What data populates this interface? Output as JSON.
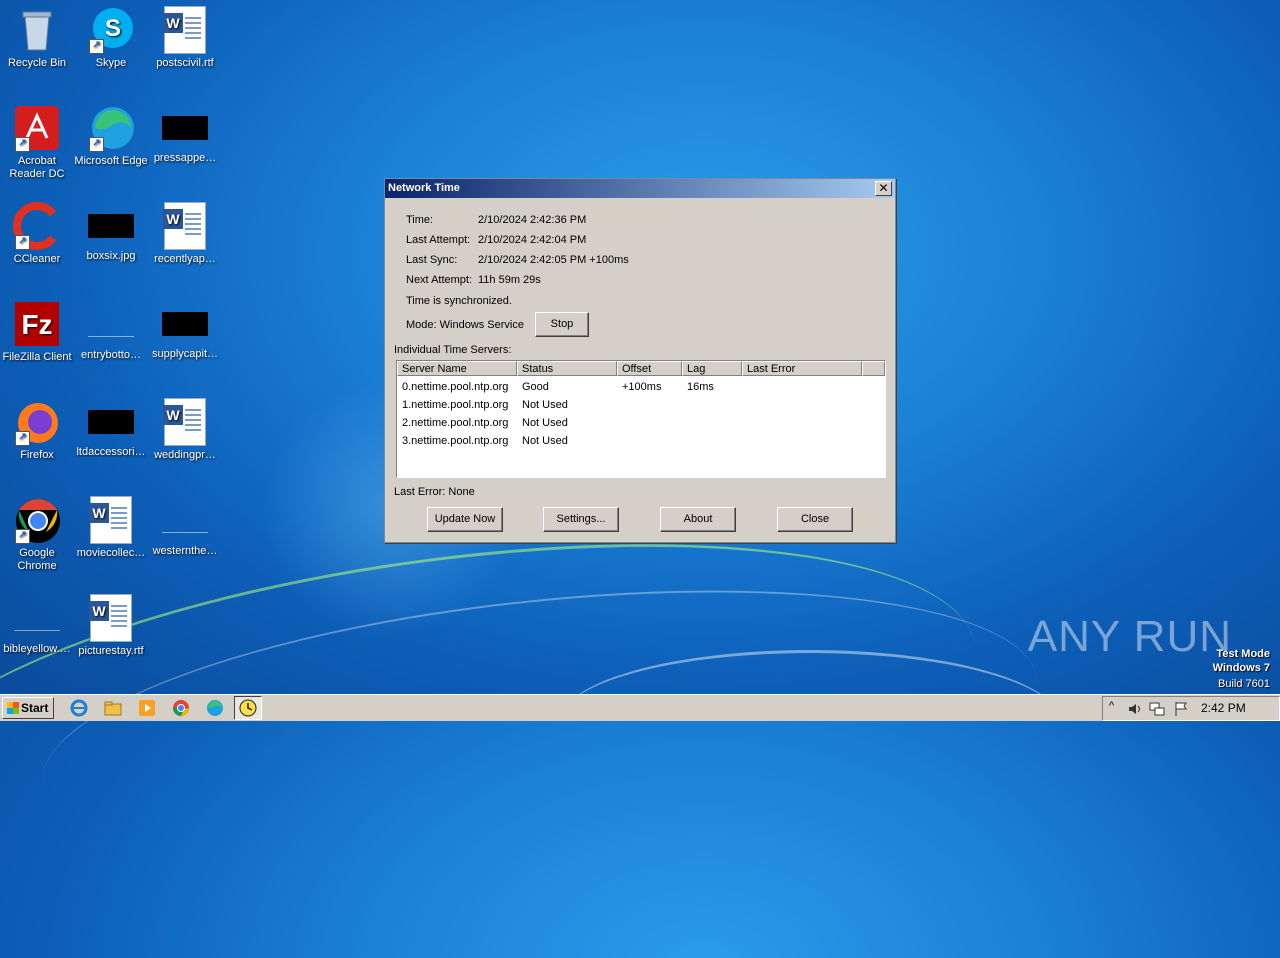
{
  "desktop": {
    "icons": [
      {
        "label": "Recycle Bin"
      },
      {
        "label": "Skype"
      },
      {
        "label": "postscivil.rtf"
      },
      {
        "label": "Acrobat Reader DC"
      },
      {
        "label": "Microsoft Edge"
      },
      {
        "label": "pressappe…"
      },
      {
        "label": "CCleaner"
      },
      {
        "label": "boxsix.jpg"
      },
      {
        "label": "recentlyap…"
      },
      {
        "label": "FileZilla Client"
      },
      {
        "label": "entrybotto…"
      },
      {
        "label": "supplycapit…"
      },
      {
        "label": "Firefox"
      },
      {
        "label": "ltdaccessori…"
      },
      {
        "label": "weddingpr…"
      },
      {
        "label": "Google Chrome"
      },
      {
        "label": "moviecollec…"
      },
      {
        "label": "westernthe…"
      },
      {
        "label": "bibleyellow.…"
      },
      {
        "label": "picturestay.rtf"
      }
    ]
  },
  "dialog": {
    "title": "Network Time",
    "close_glyph": "✕",
    "time_label": "Time:",
    "time_value": "2/10/2024 2:42:36 PM",
    "last_attempt_label": "Last Attempt:",
    "last_attempt_value": "2/10/2024 2:42:04 PM",
    "last_sync_label": "Last Sync:",
    "last_sync_value": "2/10/2024 2:42:05 PM +100ms",
    "next_attempt_label": "Next Attempt:",
    "next_attempt_value": "11h 59m 29s",
    "status_text": "Time is synchronized.",
    "mode_text": "Mode: Windows Service",
    "stop_label": "Stop",
    "servers_label": "Individual Time Servers:",
    "columns": [
      "Server Name",
      "Status",
      "Offset",
      "Lag",
      "Last Error"
    ],
    "rows": [
      [
        "0.nettime.pool.ntp.org",
        "Good",
        "+100ms",
        "16ms",
        ""
      ],
      [
        "1.nettime.pool.ntp.org",
        "Not Used",
        "",
        "",
        ""
      ],
      [
        "2.nettime.pool.ntp.org",
        "Not Used",
        "",
        "",
        ""
      ],
      [
        "3.nettime.pool.ntp.org",
        "Not Used",
        "",
        "",
        ""
      ]
    ],
    "last_error_text": "Last Error:  None",
    "buttons": {
      "update_now": "Update Now",
      "settings": "Settings...",
      "about": "About",
      "close": "Close"
    }
  },
  "taskbar": {
    "start_label": "Start",
    "clock": "2:42 PM",
    "tray_up_arrow": "^"
  },
  "watermark": {
    "brand": "ANY RUN",
    "line1": "Test Mode",
    "line2": "Windows 7",
    "line3": "Build 7601"
  }
}
